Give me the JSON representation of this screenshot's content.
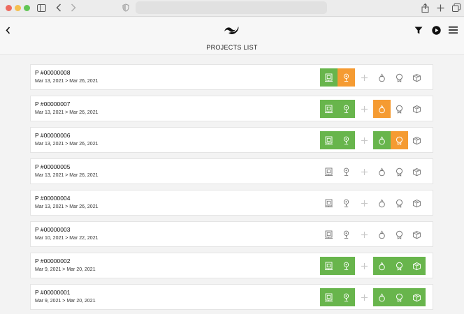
{
  "header": {
    "title": "PROJECTS LIST"
  },
  "colors": {
    "green": "#68b54c",
    "orange": "#f59b32",
    "inactive": "#777777"
  },
  "icons": {
    "chrome": [
      "sidebar-icon",
      "back-arrow-icon",
      "forward-arrow-icon",
      "shield-icon",
      "share-icon",
      "new-tab-plus-icon",
      "tabs-overview-icon"
    ],
    "app": [
      "back-chevron-icon",
      "brand-logo-icon",
      "filter-icon",
      "play-icon",
      "menu-icon"
    ],
    "steps": [
      "document-icon",
      "pin-icon",
      "add-icon",
      "ring-icon",
      "award-icon",
      "box-icon"
    ]
  },
  "projects": [
    {
      "title": "P #00000008",
      "dates": "Mar 13, 2021 > Mar 26, 2021",
      "steps": [
        "green",
        "orange",
        "plus",
        "none",
        "none",
        "none"
      ]
    },
    {
      "title": "P #00000007",
      "dates": "Mar 13, 2021 > Mar 26, 2021",
      "steps": [
        "green",
        "green",
        "plus",
        "orange",
        "none",
        "none"
      ]
    },
    {
      "title": "P #00000006",
      "dates": "Mar 13, 2021 > Mar 26, 2021",
      "steps": [
        "green",
        "green",
        "plus",
        "green",
        "orange",
        "none"
      ]
    },
    {
      "title": "P #00000005",
      "dates": "Mar 13, 2021 > Mar 26, 2021",
      "steps": [
        "none",
        "none",
        "plus",
        "none",
        "none",
        "none"
      ]
    },
    {
      "title": "P #00000004",
      "dates": "Mar 13, 2021 > Mar 26, 2021",
      "steps": [
        "none",
        "none",
        "plus",
        "none",
        "none",
        "none"
      ]
    },
    {
      "title": "P #00000003",
      "dates": "Mar 10, 2021 > Mar 22, 2021",
      "steps": [
        "none",
        "none",
        "plus",
        "none",
        "none",
        "none"
      ]
    },
    {
      "title": "P #00000002",
      "dates": "Mar 9, 2021 > Mar 20, 2021",
      "steps": [
        "green",
        "green",
        "plus",
        "green",
        "green",
        "green"
      ]
    },
    {
      "title": "P #00000001",
      "dates": "Mar 9, 2021 > Mar 20, 2021",
      "steps": [
        "green",
        "green",
        "plus",
        "green",
        "green",
        "green"
      ]
    }
  ]
}
